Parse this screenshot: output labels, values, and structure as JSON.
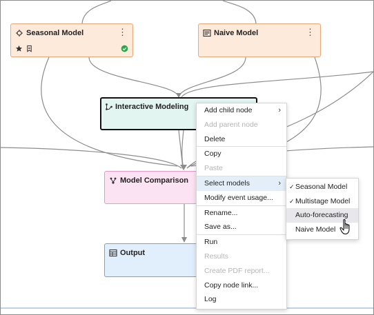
{
  "nodes": {
    "seasonal": {
      "title": "Seasonal Model",
      "icon": "seasonal-model-icon",
      "status": "success",
      "status_color": "#2ea54a"
    },
    "naive": {
      "title": "Naive Model",
      "icon": "naive-model-icon"
    },
    "interactive": {
      "title": "Interactive Modeling",
      "icon": "interactive-modeling-icon"
    },
    "comparison": {
      "title": "Model Comparison",
      "icon": "model-comparison-icon"
    },
    "output": {
      "title": "Output",
      "icon": "output-table-icon"
    }
  },
  "context_menu": {
    "items": [
      {
        "label": "Add child node",
        "has_submenu": true,
        "enabled": true
      },
      {
        "label": "Add parent node",
        "enabled": false
      },
      {
        "label": "Delete",
        "enabled": true
      },
      {
        "label": "Copy",
        "enabled": true
      },
      {
        "label": "Paste",
        "enabled": false
      },
      {
        "label": "Select models",
        "has_submenu": true,
        "enabled": true,
        "highlighted": true
      },
      {
        "label": "Modify event usage...",
        "enabled": true
      },
      {
        "label": "Rename...",
        "enabled": true
      },
      {
        "label": "Save as...",
        "enabled": true
      },
      {
        "label": "Run",
        "enabled": true
      },
      {
        "label": "Results",
        "enabled": false
      },
      {
        "label": "Create PDF report...",
        "enabled": false
      },
      {
        "label": "Copy node link...",
        "enabled": true
      },
      {
        "label": "Log",
        "enabled": true
      }
    ]
  },
  "submenu": {
    "items": [
      {
        "label": "Seasonal Model",
        "checked": true
      },
      {
        "label": "Multistage Model",
        "checked": true
      },
      {
        "label": "Auto-forecasting",
        "checked": false,
        "hovered": true
      },
      {
        "label": "Naive Model",
        "checked": false
      }
    ]
  },
  "colors": {
    "highlight": "#e3eef9",
    "edge": "#8c8c8c",
    "success": "#2ea54a"
  }
}
